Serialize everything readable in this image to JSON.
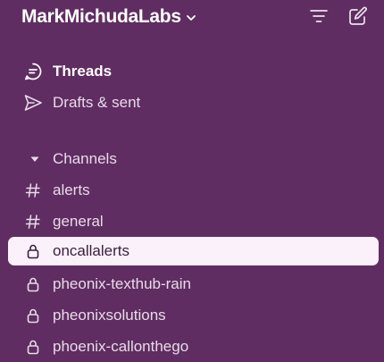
{
  "workspace": {
    "name": "MarkMichudaLabs",
    "chevron_icon": "chevron-down-icon"
  },
  "header": {
    "filter_icon": "filter-icon",
    "compose_icon": "compose-icon"
  },
  "nav": {
    "threads_label": "Threads",
    "drafts_label": "Drafts & sent"
  },
  "channels": {
    "section_label": "Channels",
    "items": [
      {
        "name": "alerts",
        "type": "public"
      },
      {
        "name": "general",
        "type": "public"
      },
      {
        "name": "oncallalerts",
        "type": "private",
        "selected": true
      },
      {
        "name": "pheonix-texthub-rain",
        "type": "private"
      },
      {
        "name": "pheonixsolutions",
        "type": "private"
      },
      {
        "name": "phoenix-callonthego",
        "type": "private"
      }
    ]
  },
  "colors": {
    "sidebar_bg": "#5f2d61",
    "selected_bg": "#fbf1fb",
    "text": "#e8dbe9"
  }
}
